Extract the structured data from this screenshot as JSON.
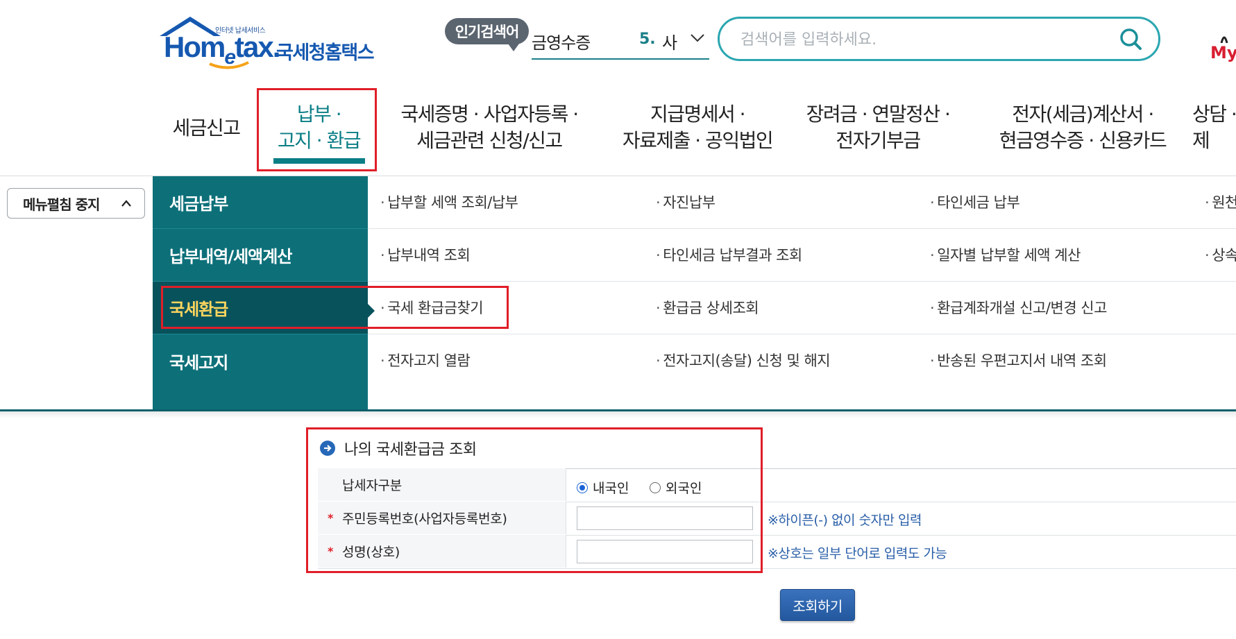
{
  "header": {
    "logo_small_text": "인터넷 납세서비스",
    "logo_word_a": "Hom",
    "logo_word_e": "e",
    "logo_word_b": "tax",
    "logo_korean": "국세청홈택스",
    "popular_tag": "인기검색어",
    "popular_term": "금영수증",
    "popular_rank": "5.",
    "popular_term2": "사",
    "search_placeholder": "검색어를 입력하세요.",
    "my_label": "My"
  },
  "nav": {
    "tax_report": "세금신고",
    "payment_line1": "납부 ·",
    "payment_line2": "고지 · 환급",
    "cert_line1": "국세증명 · 사업자등록 ·",
    "cert_line2": "세금관련 신청/신고",
    "statement_line1": "지급명세서 ·",
    "statement_line2": "자료제출 · 공익법인",
    "incentive_line1": "장려금 · 연말정산 ·",
    "incentive_line2": "전자기부금",
    "einvoice_line1": "전자(세금)계산서 ·",
    "einvoice_line2": "현금영수증 · 신용카드",
    "counsel_line1": "상담 ·",
    "counsel_line2": "제"
  },
  "mega_menu": {
    "stop_button": "메뉴펼침 중지",
    "categories": [
      "세금납부",
      "납부내역/세액계산",
      "국세환급",
      "국세고지"
    ],
    "rows": [
      [
        "납부할 세액 조회/납부",
        "자진납부",
        "타인세금 납부",
        "원천"
      ],
      [
        "납부내역 조회",
        "타인세금 납부결과 조회",
        "일자별 납부할 세액 계산",
        "상속"
      ],
      [
        "국세 환급금찾기",
        "환급금 상세조회",
        "환급계좌개설 신고/변경 신고",
        ""
      ],
      [
        "전자고지 열람",
        "전자고지(송달) 신청 및 해지",
        "반송된 우편고지서 내역 조회",
        ""
      ]
    ]
  },
  "form": {
    "title": "나의 국세환급금 조회",
    "taxpayer_type_label": "납세자구분",
    "radio_domestic": "내국인",
    "radio_foreign": "외국인",
    "id_label": "주민등록번호(사업자등록번호)",
    "id_hint": "※하이픈(-) 없이 숫자만 입력",
    "name_label": "성명(상호)",
    "name_hint": "※상호는 일부 단어로 입력도 가능",
    "required_mark": "*",
    "submit": "조회하기"
  },
  "colors": {
    "teal": "#0d7079",
    "active_teal": "#08525c",
    "highlight_red": "#e01e28",
    "active_text": "#ffd65e"
  }
}
